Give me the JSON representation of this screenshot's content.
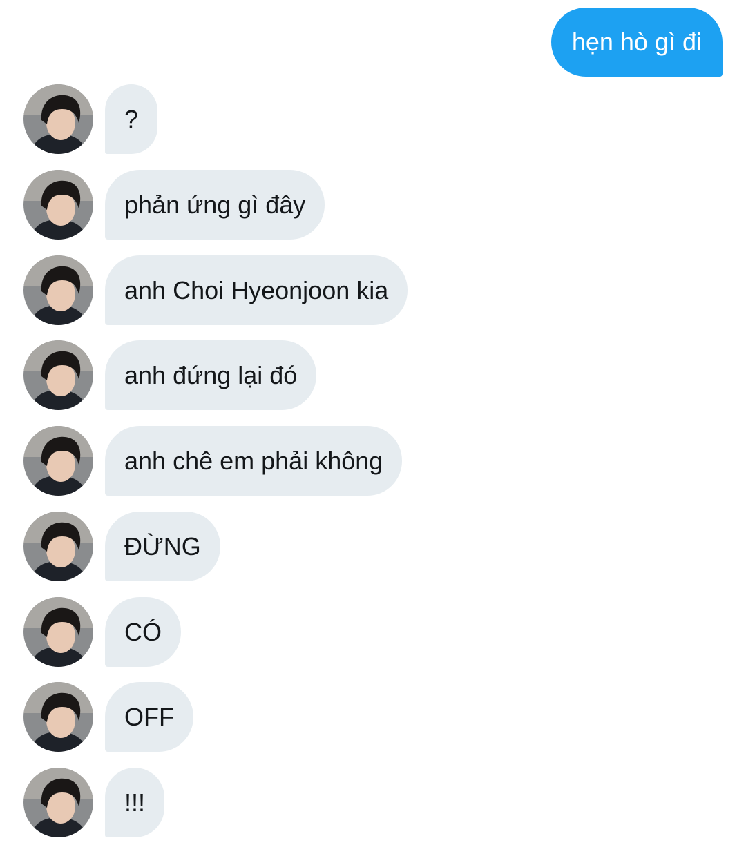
{
  "conversation": {
    "sent_messages": [
      {
        "text": "hẹn hò gì đi"
      }
    ],
    "received_messages": [
      {
        "text": "?"
      },
      {
        "text": "phản ứng gì đây"
      },
      {
        "text": "anh Choi Hyeonjoon kia"
      },
      {
        "text": "anh đứng lại đó"
      },
      {
        "text": "anh chê em phải không"
      },
      {
        "text": "ĐỪNG"
      },
      {
        "text": "CÓ"
      },
      {
        "text": "OFF"
      },
      {
        "text": "!!!"
      }
    ]
  },
  "colors": {
    "sent_bubble": "#1da1f2",
    "received_bubble": "#e6ecf0",
    "received_text": "#14171a",
    "sent_text": "#ffffff"
  }
}
